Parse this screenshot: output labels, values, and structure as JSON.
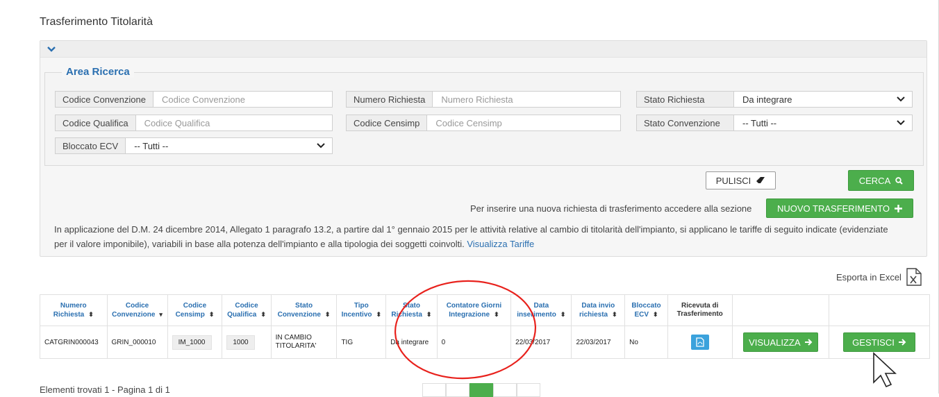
{
  "page": {
    "title": "Trasferimento Titolarità"
  },
  "search": {
    "legend": "Area Ricerca",
    "codice_convenzione": {
      "label": "Codice Convenzione",
      "placeholder": "Codice Convenzione"
    },
    "codice_qualifica": {
      "label": "Codice Qualifica",
      "placeholder": "Codice Qualifica"
    },
    "bloccato_ecv": {
      "label": "Bloccato ECV",
      "value": "-- Tutti --"
    },
    "numero_richiesta": {
      "label": "Numero Richiesta",
      "placeholder": "Numero Richiesta"
    },
    "codice_censimp": {
      "label": "Codice Censimp",
      "placeholder": "Codice Censimp"
    },
    "stato_richiesta": {
      "label": "Stato Richiesta",
      "value": "Da integrare"
    },
    "stato_convenzione": {
      "label": "Stato Convenzione",
      "value": "-- Tutti --"
    }
  },
  "actions": {
    "pulisci": "PULISCI",
    "cerca": "CERCA",
    "nuovo_hint": "Per inserire una nuova richiesta di trasferimento accedere alla sezione",
    "nuovo": "NUOVO TRASFERIMENTO"
  },
  "notice": {
    "line1": "In applicazione del D.M. 24 dicembre 2014, Allegato 1 paragrafo 13.2, a partire dal 1° gennaio 2015 per le attività relative al cambio di titolarità dell'impianto, si applicano le tariffe di seguito indicate (evidenziate",
    "line2": "per il valore imponibile), variabili in base alla potenza dell'impianto e alla tipologia dei soggetti coinvolti.",
    "link": "Visualizza Tariffe"
  },
  "export": {
    "label": "Esporta in Excel"
  },
  "table": {
    "headers": [
      {
        "l1": "Numero",
        "l2": "Richiesta",
        "sort": "⬍"
      },
      {
        "l1": "Codice",
        "l2": "Convenzione",
        "sort": "▾"
      },
      {
        "l1": "Codice",
        "l2": "Censimp",
        "sort": "⬍"
      },
      {
        "l1": "Codice",
        "l2": "Qualifica",
        "sort": "⬍"
      },
      {
        "l1": "Stato",
        "l2": "Convenzione",
        "sort": "⬍"
      },
      {
        "l1": "Tipo",
        "l2": "Incentivo",
        "sort": "⬍"
      },
      {
        "l1": "Stato",
        "l2": "Richiesta",
        "sort": "⬍"
      },
      {
        "l1": "Contatore Giorni",
        "l2": "Integrazione",
        "sort": "⬍"
      },
      {
        "l1": "Data",
        "l2": "inserimento",
        "sort": "⬍"
      },
      {
        "l1": "Data invio",
        "l2": "richiesta",
        "sort": "⬍"
      },
      {
        "l1": "Bloccato",
        "l2": "ECV",
        "sort": "⬍"
      },
      {
        "l1": "Ricevuta di",
        "l2": "Trasferimento",
        "sort": ""
      }
    ],
    "row": {
      "numero_richiesta": "CATGRIN000043",
      "codice_convenzione": "GRIN_000010",
      "codice_censimp": "IM_1000",
      "codice_qualifica": "1000",
      "stato_convenzione": "IN CAMBIO TITOLARITA'",
      "tipo_incentivo": "TIG",
      "stato_richiesta": "Da integrare",
      "contatore_giorni": "0",
      "data_inserimento": "22/03/2017",
      "data_invio": "22/03/2017",
      "bloccato_ecv": "No",
      "visualizza": "VISUALIZZA",
      "gestisci": "GESTISCI"
    }
  },
  "footer": {
    "found": "Elementi trovati 1 - Pagina 1 di 1"
  },
  "colors": {
    "accent": "#2a6fb0",
    "success": "#4cae4c",
    "info": "#3ba2dc",
    "annotation": "#e8211c"
  }
}
